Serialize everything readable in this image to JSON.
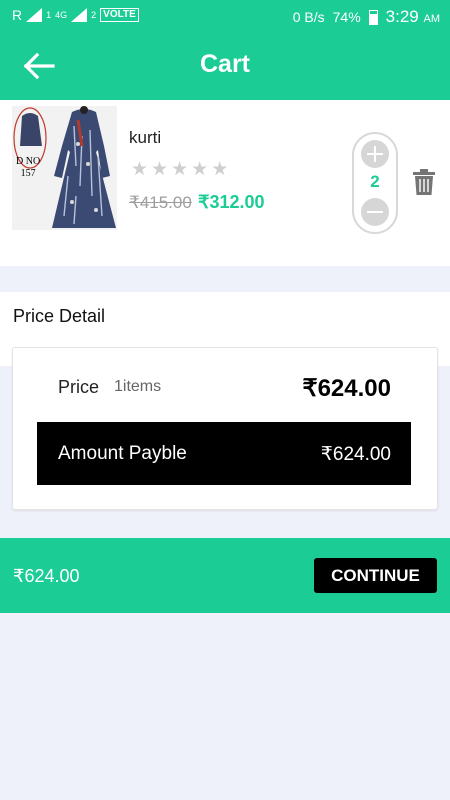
{
  "status_bar": {
    "carrier_r": "R",
    "sub1": "1",
    "net_4g": "4G",
    "sub2": "2",
    "volte": "VOLTE",
    "data_speed": "0 B/s",
    "battery_percent": "74%",
    "time": "3:29",
    "ampm": "AM"
  },
  "app_bar": {
    "title": "Cart",
    "back_icon": "arrow-left-icon"
  },
  "cart_item": {
    "image_label_line1": "D NO",
    "image_label_line2": "157",
    "name": "kurti",
    "rating": 0,
    "rating_max": 5,
    "original_price": "₹415.00",
    "discounted_price": "₹312.00",
    "quantity": "2",
    "delete_icon": "trash-icon"
  },
  "price_detail": {
    "heading": "Price Detail",
    "price_label": "Price",
    "items_count": "1items",
    "price_value": "₹624.00",
    "amount_label": "Amount Payble",
    "amount_value": "₹624.00"
  },
  "checkout": {
    "total": "₹624.00",
    "continue_label": "CONTINUE"
  },
  "colors": {
    "accent": "#1bcc95",
    "background": "#eef0fa",
    "dark": "#000000"
  }
}
